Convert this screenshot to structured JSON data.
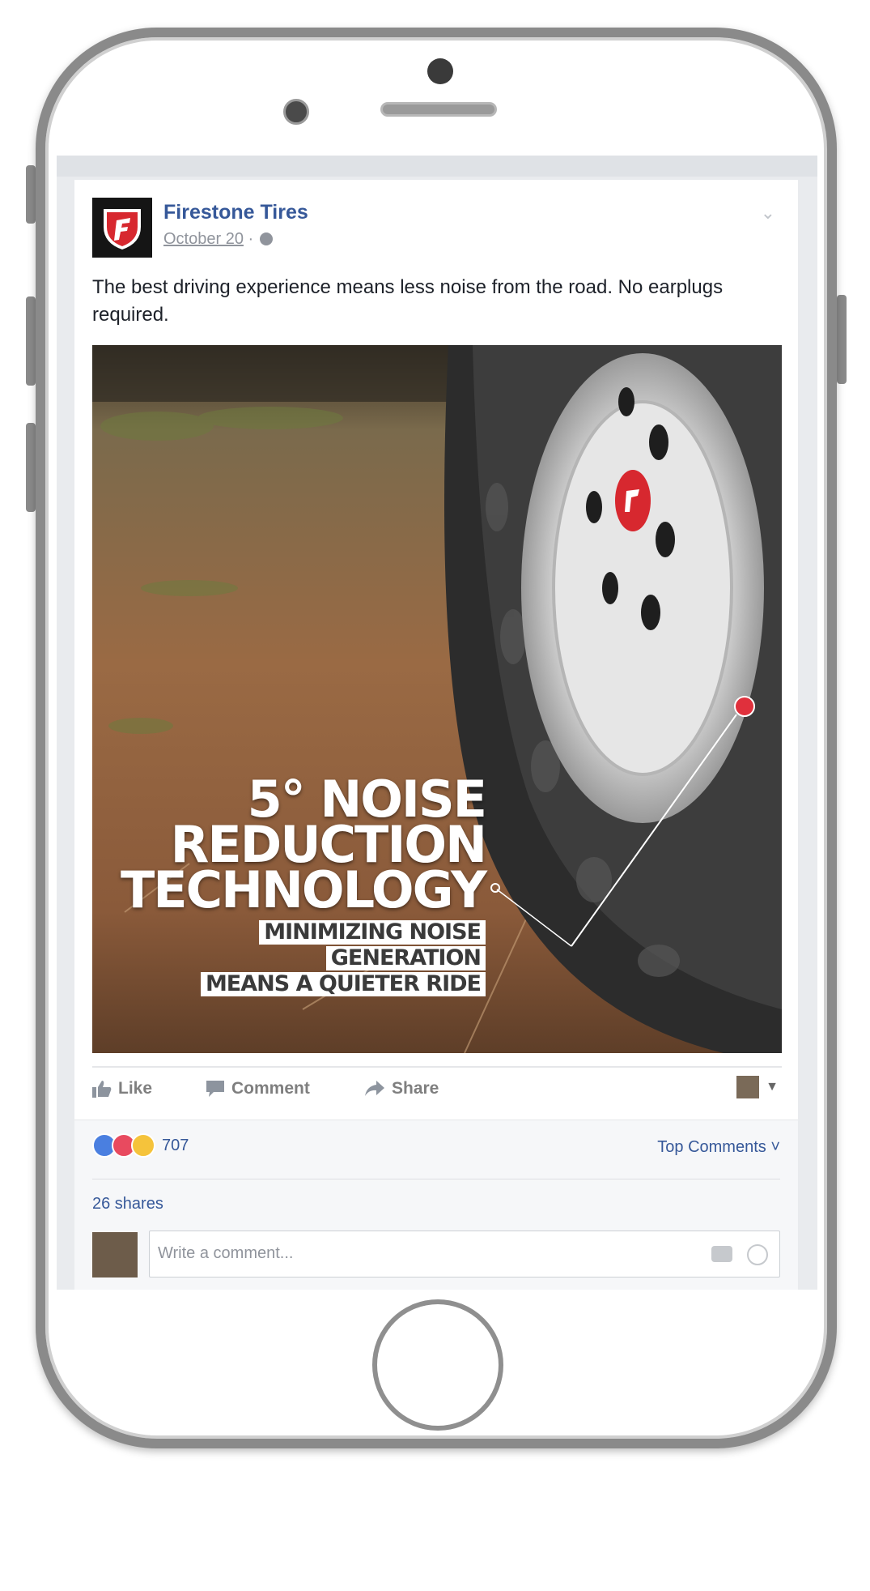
{
  "post": {
    "page_name": "Firestone Tires",
    "date": "October 20",
    "separator": "·",
    "text": "The best driving experience means less noise from the road. No earplugs required.",
    "image": {
      "title_line1": "5° NOISE",
      "title_line2": "REDUCTION",
      "title_line3": "TECHNOLOGY",
      "box_line1": "MINIMIZING NOISE",
      "box_line2": "GENERATION",
      "box_line3": "MEANS A QUIETER RIDE"
    }
  },
  "actions": {
    "like": "Like",
    "comment": "Comment",
    "share": "Share"
  },
  "stats": {
    "reaction_count": "707",
    "top_comments": "Top Comments ˅",
    "shares": "26 shares"
  },
  "comment": {
    "placeholder": "Write a comment..."
  },
  "icons": [
    "firestone-logo",
    "globe-icon",
    "like-icon",
    "comment-icon",
    "share-icon",
    "camera-icon",
    "emoji-icon"
  ],
  "colors": {
    "link": "#365899",
    "phone_frame": "#8a8a8a",
    "brand_red": "#d7282f"
  }
}
